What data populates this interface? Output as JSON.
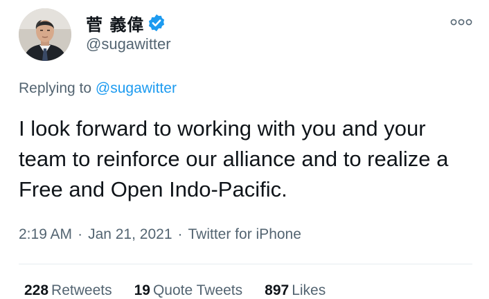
{
  "author": {
    "display_name": "菅 義偉",
    "handle": "@sugawitter",
    "verified_icon": "verified-badge-icon",
    "avatar_icon": "profile-photo"
  },
  "more_icon": "more-dots-icon",
  "reply": {
    "prefix": "Replying to",
    "to": "@sugawitter"
  },
  "tweet": {
    "text": "I look forward to working with you and your team to reinforce our alliance and to realize a Free and Open Indo-Pacific."
  },
  "meta": {
    "time": "2:19 AM",
    "separator": "·",
    "date": "Jan 21, 2021",
    "source": "Twitter for iPhone"
  },
  "stats": {
    "retweets_count": "228",
    "retweets_label": "Retweets",
    "quotes_count": "19",
    "quotes_label": "Quote Tweets",
    "likes_count": "897",
    "likes_label": "Likes"
  },
  "colors": {
    "accent": "#1d9bf0",
    "text_primary": "#0f1419",
    "text_secondary": "#536471"
  }
}
